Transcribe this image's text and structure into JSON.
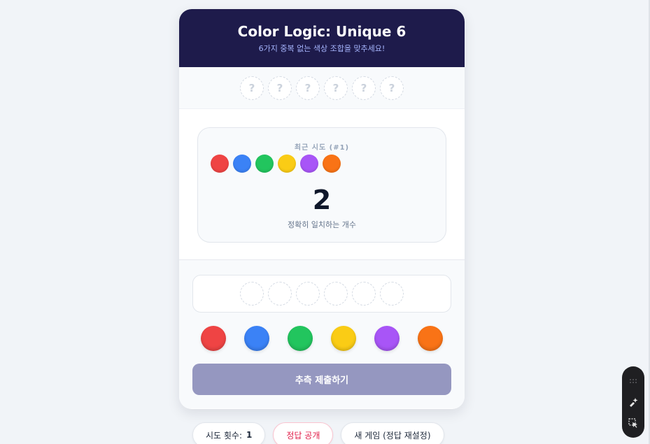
{
  "header": {
    "title": "Color Logic: Unique 6",
    "subtitle": "6가지 중복 없는 색상 조합을 맞추세요!"
  },
  "secret_slots": [
    "?",
    "?",
    "?",
    "?",
    "?",
    "?"
  ],
  "last_guess": {
    "label": "최근 시도 (#1)",
    "colors": [
      "#ef4444",
      "#3b82f6",
      "#22c55e",
      "#facc15",
      "#a855f7",
      "#f97316"
    ],
    "match_count": "2",
    "caption": "정확히 일치하는 개수"
  },
  "guess_slots_count": 6,
  "palette": [
    {
      "name": "red",
      "color": "#ef4444"
    },
    {
      "name": "blue",
      "color": "#3b82f6"
    },
    {
      "name": "green",
      "color": "#22c55e"
    },
    {
      "name": "yellow",
      "color": "#facc15"
    },
    {
      "name": "purple",
      "color": "#a855f7"
    },
    {
      "name": "orange",
      "color": "#f97316"
    }
  ],
  "submit_label": "추측 제출하기",
  "footer": {
    "attempts_label": "시도 횟수:",
    "attempts_value": "1",
    "reveal_label": "정답 공개",
    "new_game_label": "새 게임 (정답 재설정)"
  },
  "toolbar_icons": [
    "grip-icon",
    "sparkle-icon",
    "select-cursor-icon"
  ],
  "colors": {
    "header_bg": "#1e1b4b",
    "subtitle": "#a5b4fc",
    "submit_bg": "#9597c0",
    "reveal_text": "#e11d48"
  }
}
